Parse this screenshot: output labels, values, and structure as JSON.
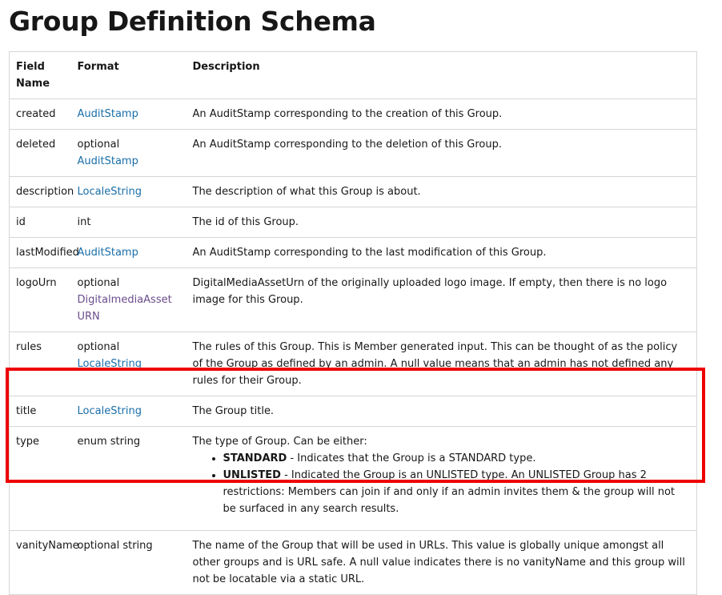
{
  "title": "Group Definition Schema",
  "headers": {
    "field": "Field Name",
    "format": "Format",
    "description": "Description"
  },
  "rows": [
    {
      "field": "created",
      "prefix": "",
      "link": "AuditStamp",
      "link2": "",
      "plain": "",
      "desc": "An AuditStamp corresponding to the creation of this Group."
    },
    {
      "field": "deleted",
      "prefix": "optional",
      "link": "AuditStamp",
      "link2": "",
      "plain": "",
      "desc": "An AuditStamp corresponding to the deletion of this Group."
    },
    {
      "field": "description",
      "prefix": "",
      "link": "LocaleString",
      "link2": "",
      "plain": "",
      "desc": "The description of what this Group is about."
    },
    {
      "field": "id",
      "prefix": "",
      "link": "",
      "link2": "",
      "plain": "int",
      "desc": "The id of this Group."
    },
    {
      "field": "lastModified",
      "prefix": "",
      "link": "AuditStamp",
      "link2": "",
      "plain": "",
      "desc": "An AuditStamp corresponding to the last modification of this Group."
    },
    {
      "field": "logoUrn",
      "prefix": "optional",
      "link": "",
      "link2": "DigitalmediaAsset URN",
      "plain": "",
      "desc": "DigitalMediaAssetUrn of the originally uploaded logo image. If empty, then there is no logo image for this Group."
    },
    {
      "field": "rules",
      "prefix": "optional",
      "link": "LocaleString",
      "link2": "",
      "plain": "",
      "desc": "The rules of this Group. This is Member generated input. This can be thought of as the policy of the Group as defined by an admin. A null value means that an admin has not defined any rules for their Group."
    },
    {
      "field": "title",
      "prefix": "",
      "link": "LocaleString",
      "link2": "",
      "plain": "",
      "desc": "The Group title."
    },
    {
      "field": "type",
      "plain": "enum string",
      "desc_intro": "The type of Group. Can be either:",
      "enum_items": [
        {
          "term": "STANDARD",
          "text": " - Indicates that the Group is a STANDARD type."
        },
        {
          "term": "UNLISTED",
          "text": " - Indicated the Group is an UNLISTED type. An UNLISTED Group has 2 restrictions: Members can join if and only if an admin invites them & the group will not be surfaced in any search results."
        }
      ]
    },
    {
      "field": "vanityName",
      "prefix": "",
      "link": "",
      "link2": "",
      "plain": "optional string",
      "desc": "The name of the Group that will be used in URLs. This value is globally unique amongst all other groups and is URL safe. A null value indicates there is no vanityName and this group will not be locatable via a static URL."
    }
  ],
  "highlight_color": "#ee0000",
  "link_color": "#1a6ea8",
  "visited_link_color": "#6a4c8c"
}
